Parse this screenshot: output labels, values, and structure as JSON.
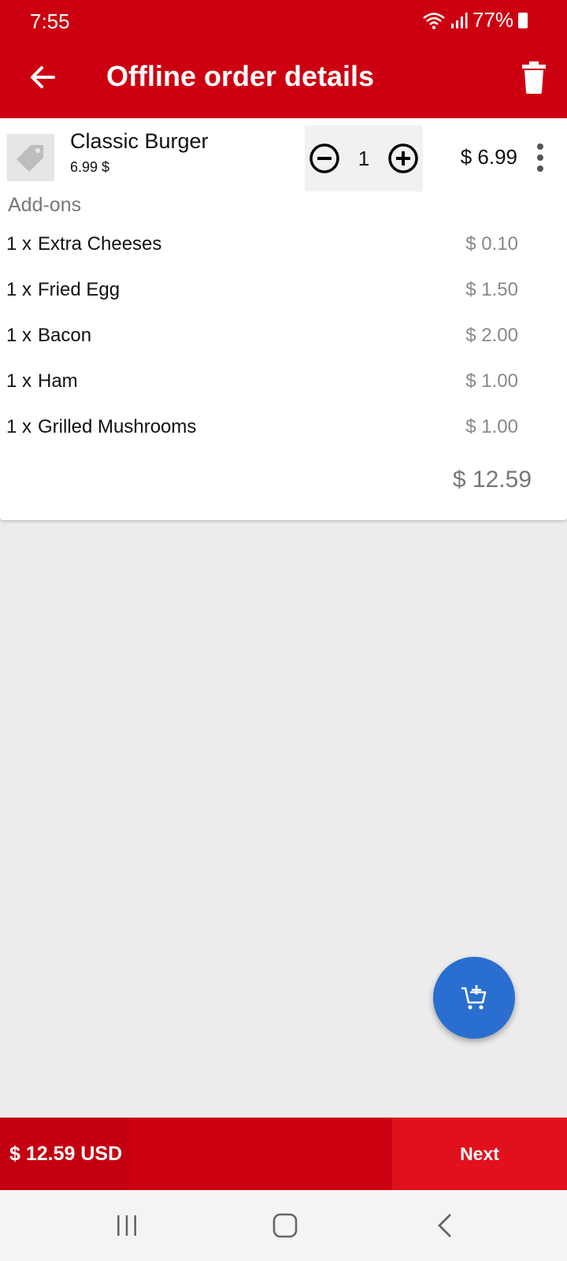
{
  "status_bar": {
    "time": "7:55",
    "battery": "77%",
    "icons": [
      "wifi-icon",
      "signal-icon",
      "battery-icon"
    ]
  },
  "app_bar": {
    "title": "Offline order details",
    "back_icon": "arrow-left-icon",
    "delete_icon": "trash-icon"
  },
  "order_item": {
    "name": "Classic Burger",
    "unit_price": "6.99 $",
    "quantity": "1",
    "line_price": "$ 6.99",
    "thumb_icon": "tag-icon"
  },
  "addons": {
    "heading": "Add-ons",
    "items": [
      {
        "qty": "1 x",
        "name": "Extra Cheeses",
        "price": "$ 0.10"
      },
      {
        "qty": "1 x",
        "name": "Fried Egg",
        "price": "$ 1.50"
      },
      {
        "qty": "1 x",
        "name": "Bacon",
        "price": "$ 2.00"
      },
      {
        "qty": "1 x",
        "name": "Ham",
        "price": "$ 1.00"
      },
      {
        "qty": "1 x",
        "name": "Grilled Mushrooms",
        "price": "$ 1.00"
      }
    ]
  },
  "order_total": "$ 12.59",
  "bottom_bar": {
    "total": "$ 12.59 USD",
    "next_label": "Next"
  },
  "colors": {
    "primary_red": "#cc0011",
    "next_red": "#e0101c",
    "fab_blue": "#2a6fcf",
    "background": "#ececec"
  }
}
